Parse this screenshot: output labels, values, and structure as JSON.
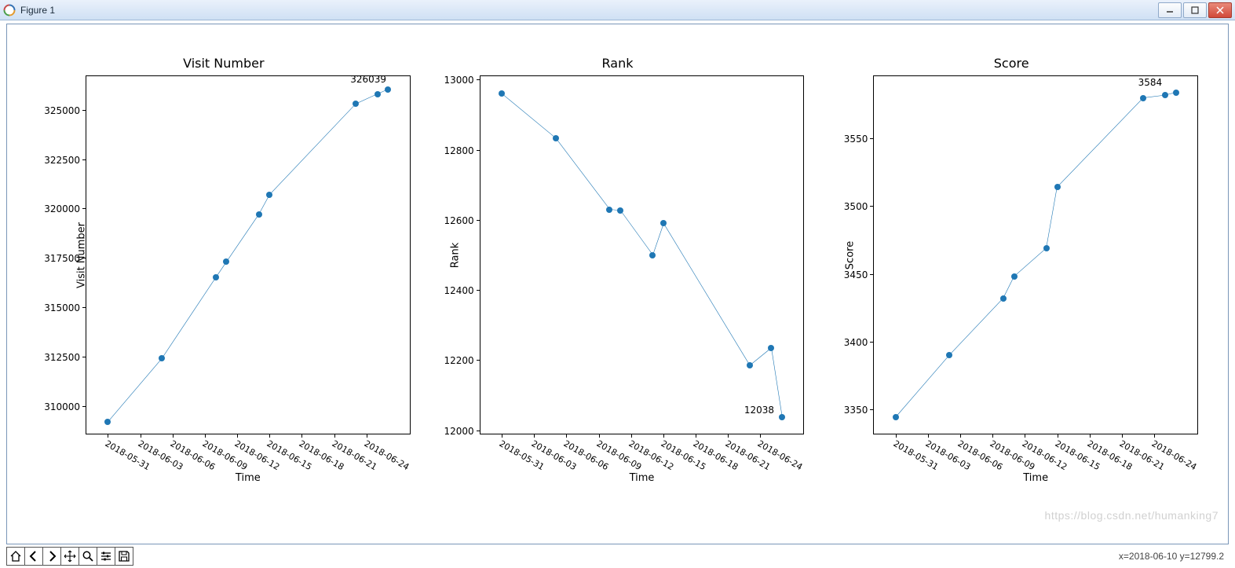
{
  "window": {
    "title": "Figure 1"
  },
  "toolbar": {
    "coord_readout": "x=2018-06-10 y=12799.2"
  },
  "watermark": "https://blog.csdn.net/humanking7",
  "chart_data": [
    {
      "type": "line",
      "title": "Visit Number",
      "xlabel": "Time",
      "ylabel": "Visit Number",
      "annotation": "326039",
      "y_ticks": [
        310000,
        312500,
        315000,
        317500,
        320000,
        322500,
        325000
      ],
      "ylim": [
        308600,
        326700
      ],
      "x_ticks": [
        "2018-05-31",
        "2018-06-03",
        "2018-06-06",
        "2018-06-09",
        "2018-06-12",
        "2018-06-15",
        "2018-06-18",
        "2018-06-21",
        "2018-06-24"
      ],
      "x_index_range": [
        -2,
        28
      ],
      "series": [
        {
          "name": "Visit Number",
          "x_index": [
            0,
            5,
            10,
            11,
            14,
            15,
            23,
            25,
            26
          ],
          "values": [
            309200,
            312400,
            316500,
            317300,
            319700,
            320700,
            325300,
            325800,
            326039
          ]
        }
      ]
    },
    {
      "type": "line",
      "title": "Rank",
      "xlabel": "Time",
      "ylabel": "Rank",
      "annotation": "12038",
      "y_ticks": [
        12000,
        12200,
        12400,
        12600,
        12800,
        13000
      ],
      "ylim": [
        11990,
        13010
      ],
      "x_ticks": [
        "2018-05-31",
        "2018-06-03",
        "2018-06-06",
        "2018-06-09",
        "2018-06-12",
        "2018-06-15",
        "2018-06-18",
        "2018-06-21",
        "2018-06-24"
      ],
      "x_index_range": [
        -2,
        28
      ],
      "series": [
        {
          "name": "Rank",
          "x_index": [
            0,
            5,
            10,
            11,
            14,
            15,
            23,
            25,
            26
          ],
          "values": [
            12960,
            12833,
            12630,
            12627,
            12500,
            12590,
            12185,
            12235,
            12038
          ]
        }
      ]
    },
    {
      "type": "line",
      "title": "Score",
      "xlabel": "Time",
      "ylabel": "Score",
      "annotation": "3584",
      "y_ticks": [
        3350,
        3400,
        3450,
        3500,
        3550
      ],
      "ylim": [
        3332,
        3596
      ],
      "x_ticks": [
        "2018-05-31",
        "2018-06-03",
        "2018-06-06",
        "2018-06-09",
        "2018-06-12",
        "2018-06-15",
        "2018-06-18",
        "2018-06-21",
        "2018-06-24"
      ],
      "x_index_range": [
        -2,
        28
      ],
      "series": [
        {
          "name": "Score",
          "x_index": [
            0,
            5,
            10,
            11,
            14,
            15,
            23,
            25,
            26
          ],
          "values": [
            3344,
            3390,
            3432,
            3448,
            3469,
            3514,
            3580,
            3582,
            3584
          ]
        }
      ]
    }
  ]
}
